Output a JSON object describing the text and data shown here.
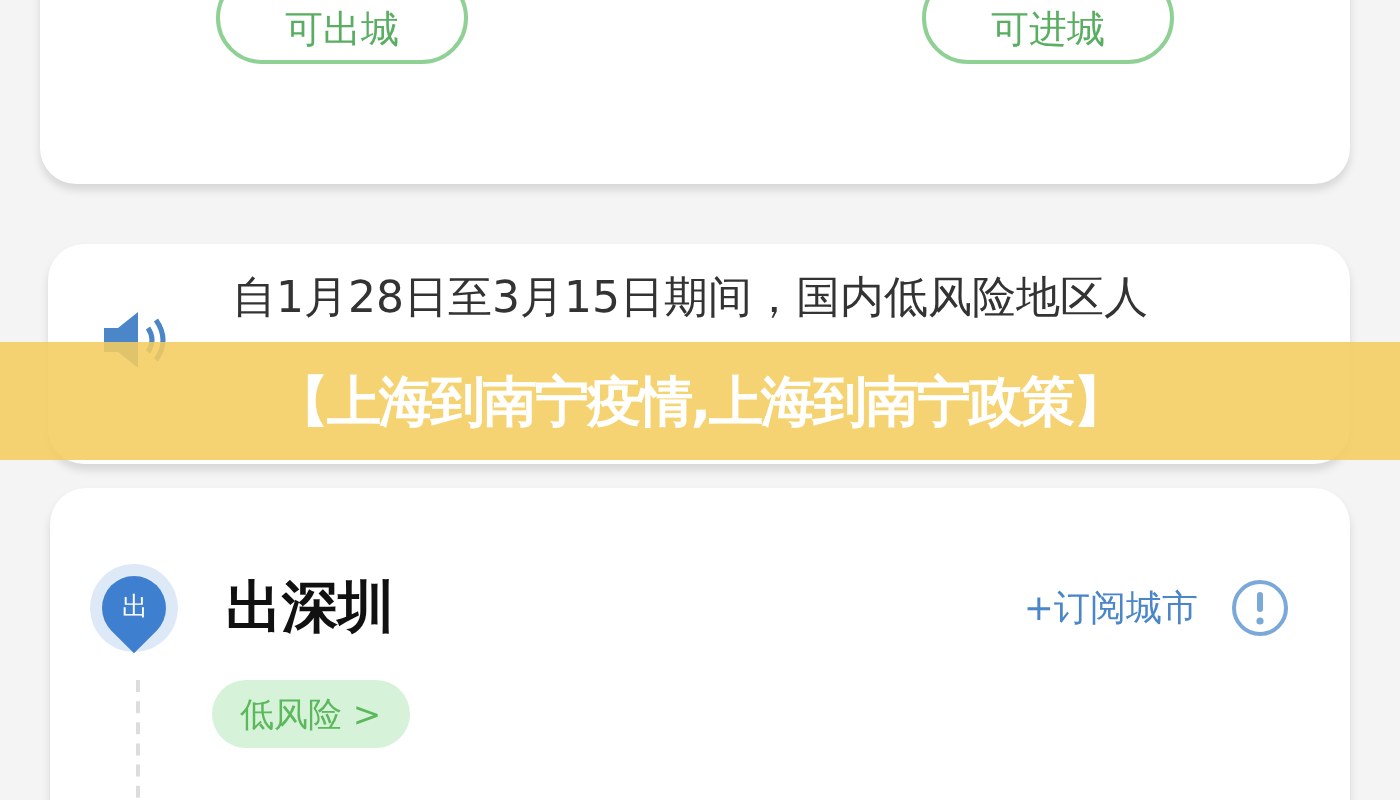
{
  "top_card": {
    "buttons": [
      "可出城",
      "可进城"
    ]
  },
  "notice": {
    "text": "自1月28日至3月15日期间，国内低风险地区人"
  },
  "banner": {
    "text": "【上海到南宁疫情,上海到南宁政策】"
  },
  "city": {
    "badge": "出",
    "name": "出深圳",
    "subscribe": "+订阅城市",
    "risk_tag": "低风险 >"
  }
}
